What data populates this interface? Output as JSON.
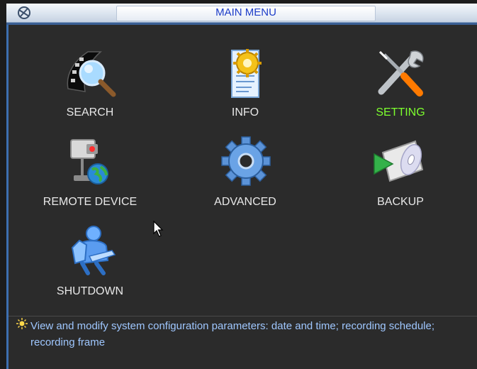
{
  "window": {
    "title": "MAIN MENU"
  },
  "menu": {
    "items": [
      {
        "label": "SEARCH",
        "icon": "search-film-icon"
      },
      {
        "label": "INFO",
        "icon": "info-document-icon"
      },
      {
        "label": "SETTING",
        "icon": "tools-icon",
        "active": true
      },
      {
        "label": "REMOTE DEVICE",
        "icon": "remote-camera-icon"
      },
      {
        "label": "ADVANCED",
        "icon": "gear-icon"
      },
      {
        "label": "BACKUP",
        "icon": "backup-disc-icon"
      },
      {
        "label": "SHUTDOWN",
        "icon": "shutdown-user-icon"
      }
    ]
  },
  "hint": {
    "text": "View and modify system configuration parameters: date and time; recording schedule; recording frame"
  },
  "colors": {
    "background": "#2b2b2b",
    "active_label": "#7dff2e",
    "hint_text": "#9fc7ff",
    "title_text": "#1c3cc8"
  }
}
